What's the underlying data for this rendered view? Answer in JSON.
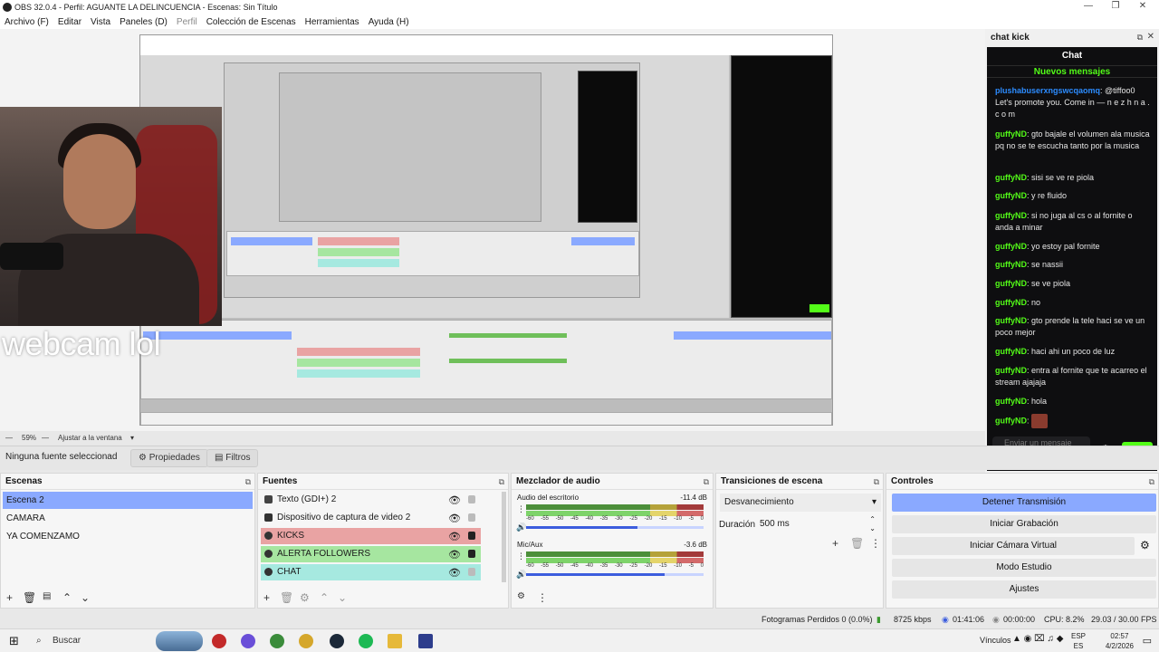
{
  "window": {
    "title": "OBS 32.0.4 - Perfil: AGUANTE LA DELINCUENCIA - Escenas: Sin Título",
    "minimize": "—",
    "maximize": "❐",
    "close": "✕"
  },
  "menu": [
    "Archivo (F)",
    "Editar",
    "Vista",
    "Paneles (D)",
    "Perfil",
    "Colección de Escenas",
    "Herramientas",
    "Ayuda (H)"
  ],
  "preview": {
    "webcam_text": "webcam lol",
    "zoom": "59%",
    "fit_label": "Ajustar a la ventana"
  },
  "chat_dock": {
    "dock_title": "chat kick",
    "title": "Chat",
    "new_messages": "Nuevos mensajes",
    "messages": [
      {
        "user": "plushabuserxngswcqaomq",
        "text": ": @tiffoo0 Let's promote you. Come in — n e z h n a . c o m"
      },
      {
        "user": "guffyND",
        "text": ": gto bajale el volumen ala musica pq no se te escucha tanto por la musica"
      },
      {
        "user": "guffyND",
        "text": ": sisi se ve re piola"
      },
      {
        "user": "guffyND",
        "text": ": y re fluido"
      },
      {
        "user": "guffyND",
        "text": ": si no juga al cs o al fornite o anda a minar"
      },
      {
        "user": "guffyND",
        "text": ": yo estoy pal fornite"
      },
      {
        "user": "guffyND",
        "text": ": se nassii"
      },
      {
        "user": "guffyND",
        "text": ": se ve piola"
      },
      {
        "user": "guffyND",
        "text": ": no"
      },
      {
        "user": "guffyND",
        "text": ": gto prende la tele haci se ve un poco mejor"
      },
      {
        "user": "guffyND",
        "text": ": haci ahi un poco de luz"
      },
      {
        "user": "guffyND",
        "text": ": entra al fornite que te acarreo el stream ajajaja"
      },
      {
        "user": "guffyND",
        "text": ": hola"
      },
      {
        "user": "guffyND",
        "text": ":"
      }
    ],
    "input_placeholder": "Enviar un mensaje",
    "send_label": "Chat"
  },
  "source_bar": {
    "no_source": "Ninguna fuente seleccionad",
    "properties": "Propiedades",
    "filters": "Filtros"
  },
  "scenes": {
    "title": "Escenas",
    "items": [
      "Escena 2",
      "CAMARA",
      "YA COMENZAMO"
    ],
    "selected": 0
  },
  "sources": {
    "title": "Fuentes",
    "items": [
      {
        "name": "Texto (GDI+) 2",
        "bg": "",
        "locked": false
      },
      {
        "name": "Dispositivo de captura de video 2",
        "bg": "",
        "locked": false
      },
      {
        "name": "KICKS",
        "bg": "#e9a3a3",
        "locked": true
      },
      {
        "name": "ALERTA FOLLOWERS",
        "bg": "#a6e6a0",
        "locked": true
      },
      {
        "name": "CHAT",
        "bg": "#a6e9e0",
        "locked": false
      }
    ]
  },
  "mixer": {
    "title": "Mezclador de audio",
    "channels": [
      {
        "name": "Audio del escritorio",
        "db": "-11.4 dB",
        "volume": 0.63
      },
      {
        "name": "Mic/Aux",
        "db": "-3.6 dB",
        "volume": 0.78
      }
    ],
    "ticks": [
      "-60",
      "-55",
      "-50",
      "-45",
      "-40",
      "-35",
      "-30",
      "-25",
      "-20",
      "-15",
      "-10",
      "-5",
      "0"
    ]
  },
  "transitions": {
    "title": "Transiciones de escena",
    "selected": "Desvanecimiento",
    "duration_label": "Duración",
    "duration_value": "500 ms"
  },
  "controls": {
    "title": "Controles",
    "buttons": [
      "Detener Transmisión",
      "Iniciar Grabación",
      "Iniciar Cámara Virtual",
      "Modo Estudio",
      "Ajustes"
    ]
  },
  "status": {
    "dropped": "Fotogramas Perdidos 0 (0.0%)",
    "bitrate": "8725 kbps",
    "live_time": "01:41:06",
    "rec_time": "00:00:00",
    "cpu": "CPU: 8.2%",
    "fps": "29.03 / 30.00 FPS"
  },
  "taskbar": {
    "search": "Buscar",
    "vinculos": "Vínculos",
    "lang_top": "ESP",
    "lang_bottom": "ES",
    "time": "02:57",
    "date": "4/2/2026"
  },
  "colors": {
    "accent_selection": "#8aa9ff",
    "kick_green": "#53fc18",
    "chat_bg": "#0e0e10"
  }
}
